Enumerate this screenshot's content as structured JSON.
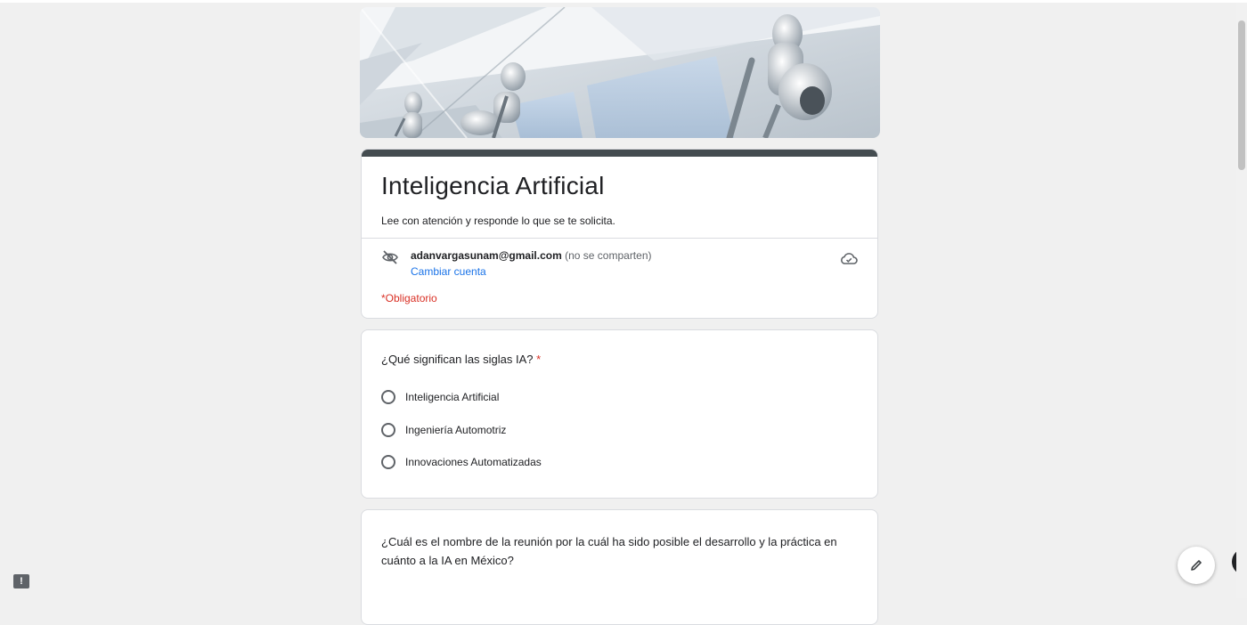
{
  "form": {
    "title": "Inteligencia Artificial",
    "description": "Lee con atención y responde lo que se te solicita.",
    "account_email": "adanvargasunam@gmail.com",
    "account_note": "(no se comparten)",
    "switch_account": "Cambiar cuenta",
    "required_note": "*Obligatorio",
    "accent_color": "#444c50",
    "required_color": "#d93025",
    "link_color": "#1a73e8"
  },
  "question1": {
    "title": "¿Qué significan las siglas IA?",
    "required_mark": "*",
    "options": [
      {
        "label": "Inteligencia Artificial"
      },
      {
        "label": "Ingeniería Automotriz"
      },
      {
        "label": "Innovaciones Automatizadas"
      }
    ]
  },
  "question2": {
    "title": "¿Cuál es el nombre de la reunión por la cuál ha sido posible el desarrollo y la práctica en cuánto a la IA en México?"
  },
  "icons": {
    "hidden": "eye-off-icon",
    "cloud": "cloud-check-icon",
    "feedback": "feedback-icon",
    "edit": "pencil-icon",
    "feedback_glyph": "!"
  }
}
